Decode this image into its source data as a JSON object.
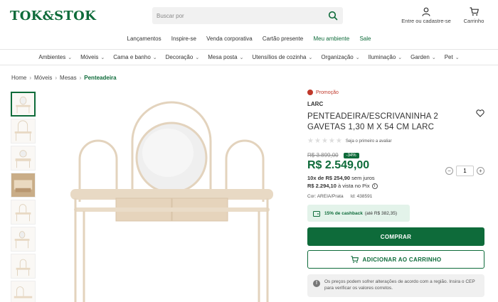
{
  "header": {
    "logo_text": "TOK&STOK",
    "search_placeholder": "Buscar por",
    "account_label": "Entre ou cadastre-se",
    "cart_label": "Carrinho"
  },
  "links": [
    {
      "label": "Lançamentos",
      "accent": false
    },
    {
      "label": "Inspire-se",
      "accent": false
    },
    {
      "label": "Venda corporativa",
      "accent": false
    },
    {
      "label": "Cartão presente",
      "accent": false
    },
    {
      "label": "Meu ambiente",
      "accent": true
    },
    {
      "label": "Sale",
      "accent": true
    }
  ],
  "categories": [
    "Ambientes",
    "Móveis",
    "Cama e banho",
    "Decoração",
    "Mesa posta",
    "Utensílios de cozinha",
    "Organização",
    "Iluminação",
    "Garden",
    "Pet"
  ],
  "breadcrumb": [
    "Home",
    "Móveis",
    "Mesas",
    "Penteadeira"
  ],
  "product": {
    "promo": "Promoção",
    "brand": "LARC",
    "title": "PENTEADEIRA/ESCRIVANINHA 2 GAVETAS 1,30 M X 54 CM LARC",
    "rating_text": "Seja o primeiro a avaliar",
    "old_price": "R$ 3.899,00",
    "discount": "-34%",
    "price": "R$ 2.549,00",
    "installments_prefix": "10x de",
    "installments_value": "R$ 254,90",
    "installments_suffix": "sem juros",
    "pix_value": "R$ 2.294,10",
    "pix_suffix": "à vista no Pix",
    "color": "Cor: AREIA/Prata",
    "id": "Id: 438591",
    "cashback_label": "15% de cashback",
    "cashback_amount": "(até R$ 382,35)",
    "buy_label": "COMPRAR",
    "add_cart_label": "ADICIONAR AO CARRINHO",
    "quantity": "1",
    "notice": "Os preços podem sofrer alterações de acordo com a região. Insira o CEP para verificar os valores corretos."
  },
  "colors": {
    "brand_green": "#0e6b3a",
    "promo_red": "#c0392b",
    "furniture_beige": "#e8d9c4"
  }
}
